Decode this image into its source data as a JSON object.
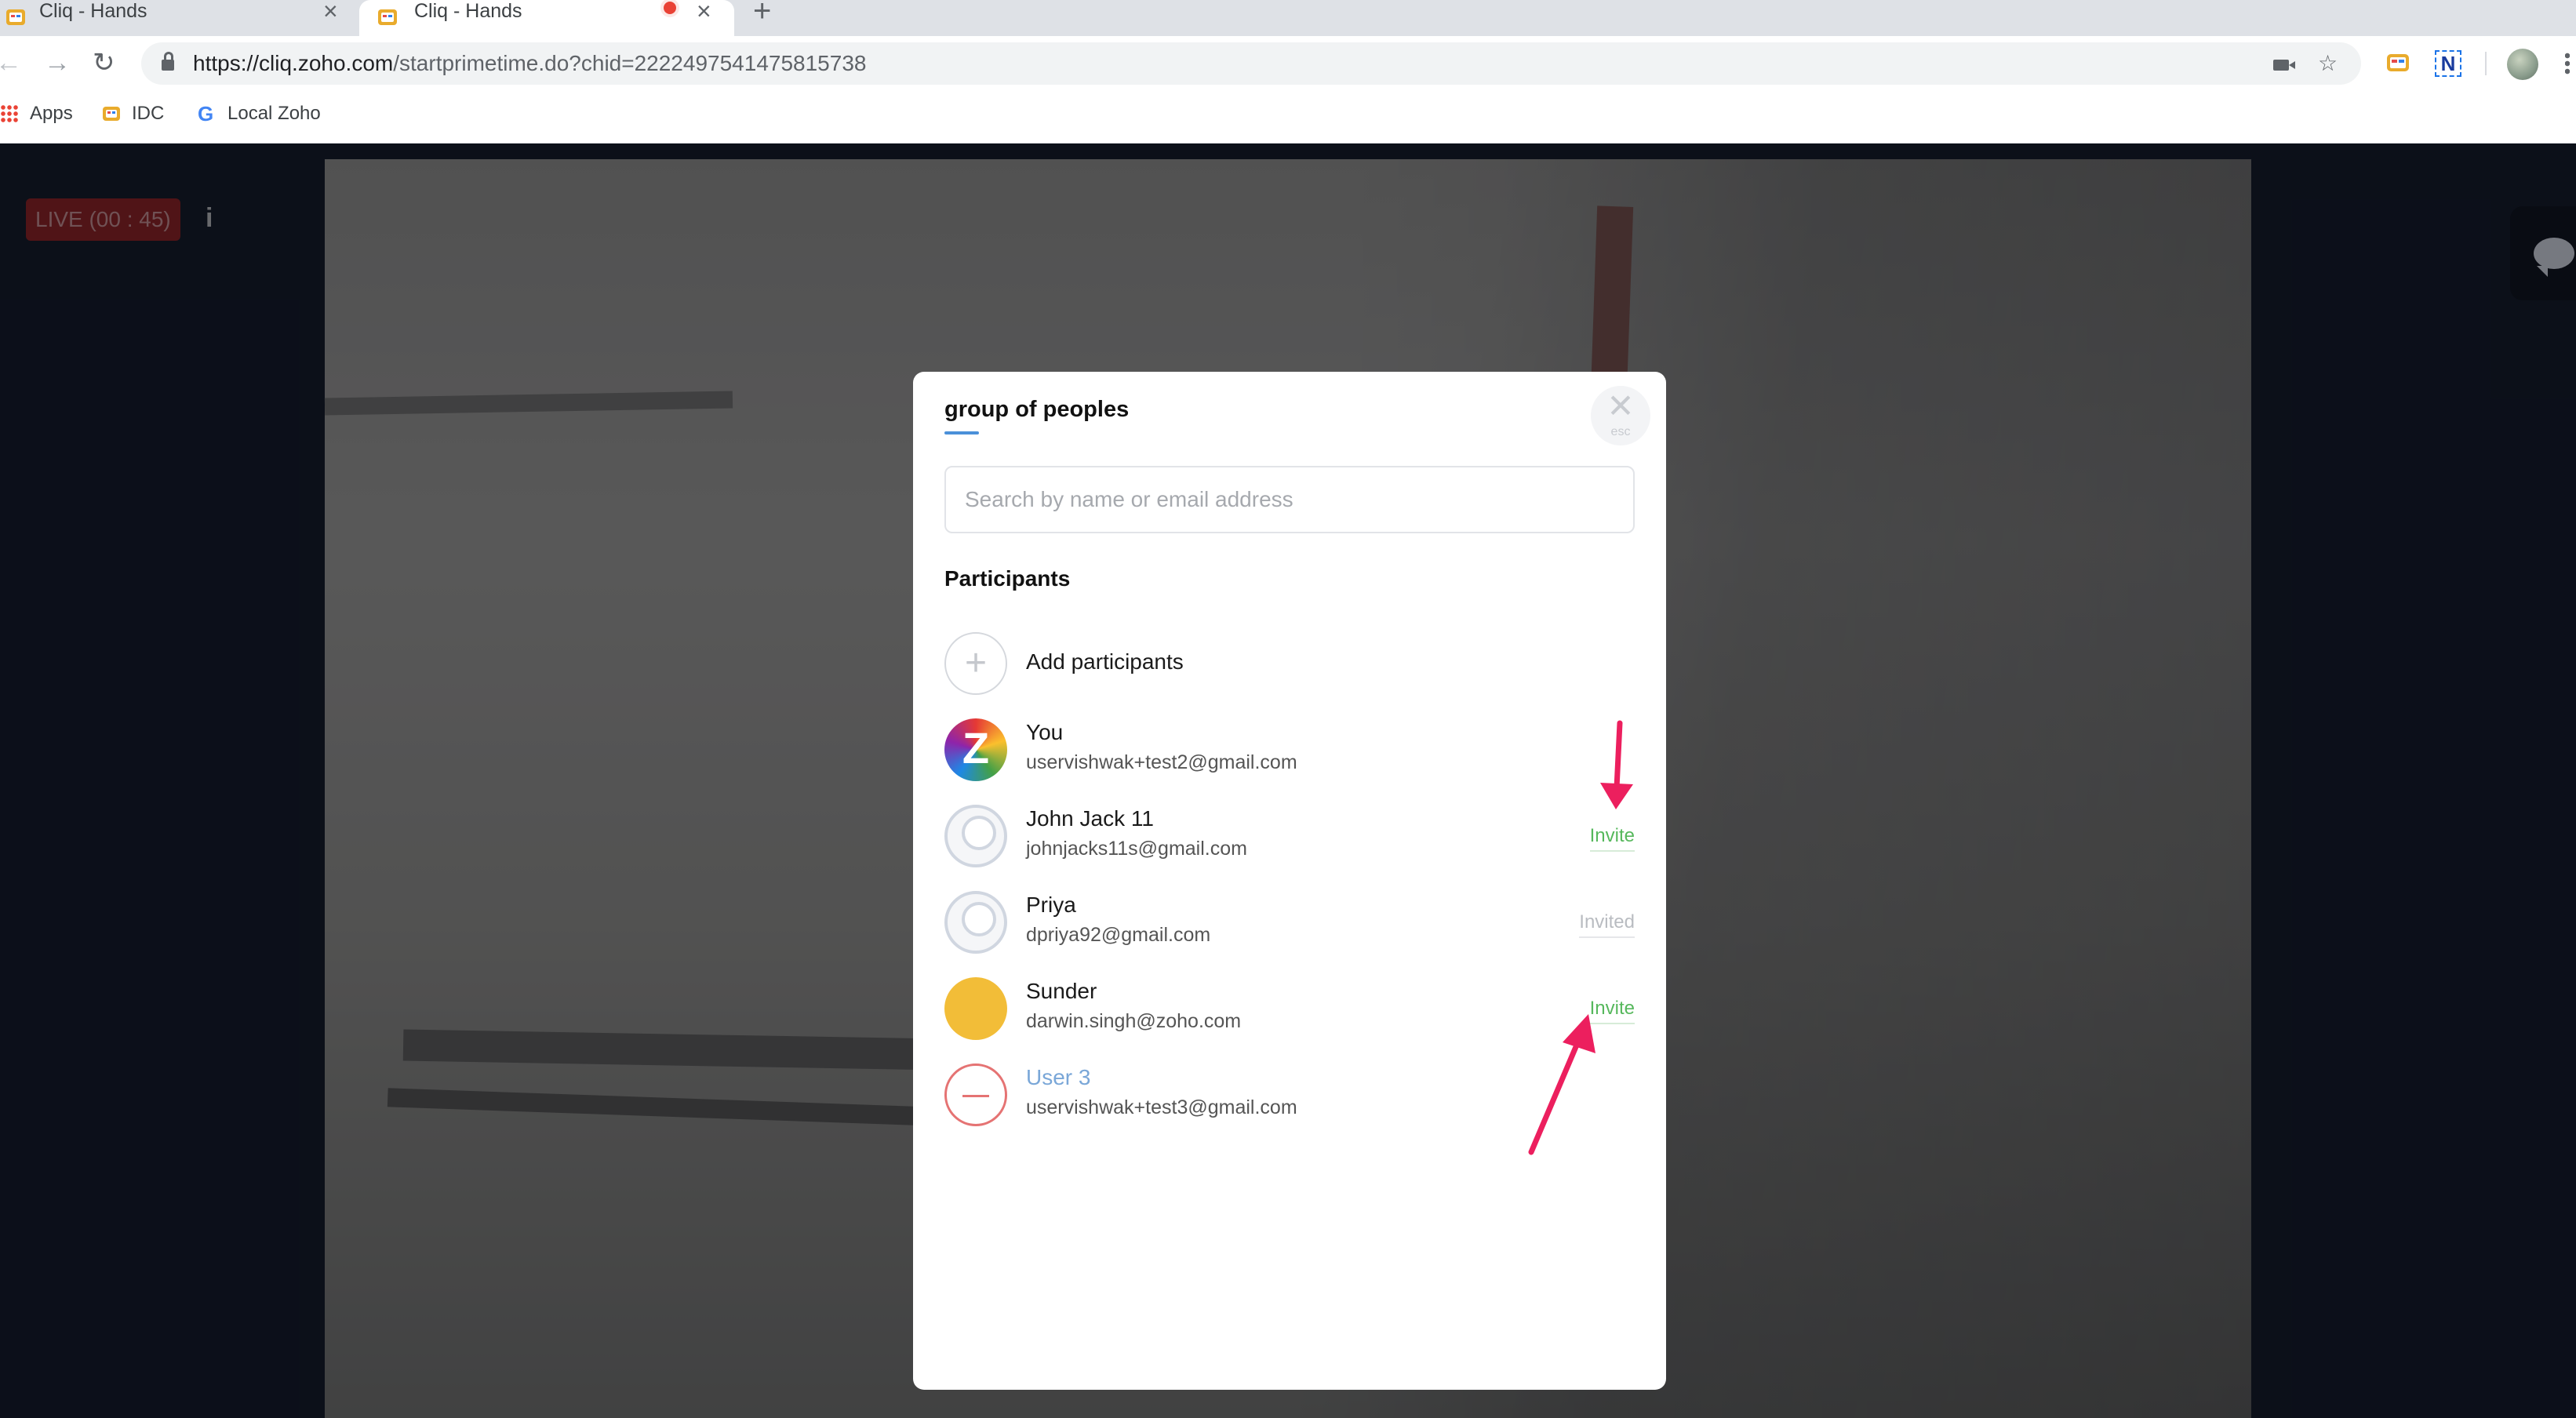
{
  "browser": {
    "tabs": [
      {
        "title": "Cliq - Hands",
        "active": false
      },
      {
        "title": "Cliq - Hands",
        "active": true,
        "recording": true
      }
    ],
    "new_tab_icon": "plus-icon",
    "url_host": "https://cliq.zoho.com",
    "url_path": "/startprimetime.do?chid=2222497541475815738",
    "bookmarks": [
      {
        "label": "Apps",
        "icon": "apps-grid-icon"
      },
      {
        "label": "IDC",
        "icon": "cliq-icon"
      },
      {
        "label": "Local Zoho",
        "icon": "google-icon"
      }
    ],
    "extension_n_label": "N"
  },
  "live": {
    "badge": "LIVE (00 : 45)",
    "info_label": "i"
  },
  "modal": {
    "title": "group  of peoples",
    "close_label": "esc",
    "search_placeholder": "Search by name or email address",
    "section_title": "Participants",
    "add_label": "Add participants",
    "participants": [
      {
        "name": "You",
        "email": "uservishwak+test2@gmail.com",
        "action": ""
      },
      {
        "name": "John Jack 11",
        "email": "johnjacks11s@gmail.com",
        "action": "Invite"
      },
      {
        "name": "Priya",
        "email": "dpriya92@gmail.com",
        "action": "Invited"
      },
      {
        "name": "Sunder",
        "email": "darwin.singh@zoho.com",
        "action": "Invite"
      },
      {
        "name": "User 3",
        "email": "uservishwak+test3@gmail.com",
        "action": ""
      }
    ]
  },
  "colors": {
    "invite": "#56b85c",
    "invited": "#b9bcc1",
    "annotation_arrow": "#ec1f5e",
    "live_badge_bg": "#8a1d1d"
  }
}
